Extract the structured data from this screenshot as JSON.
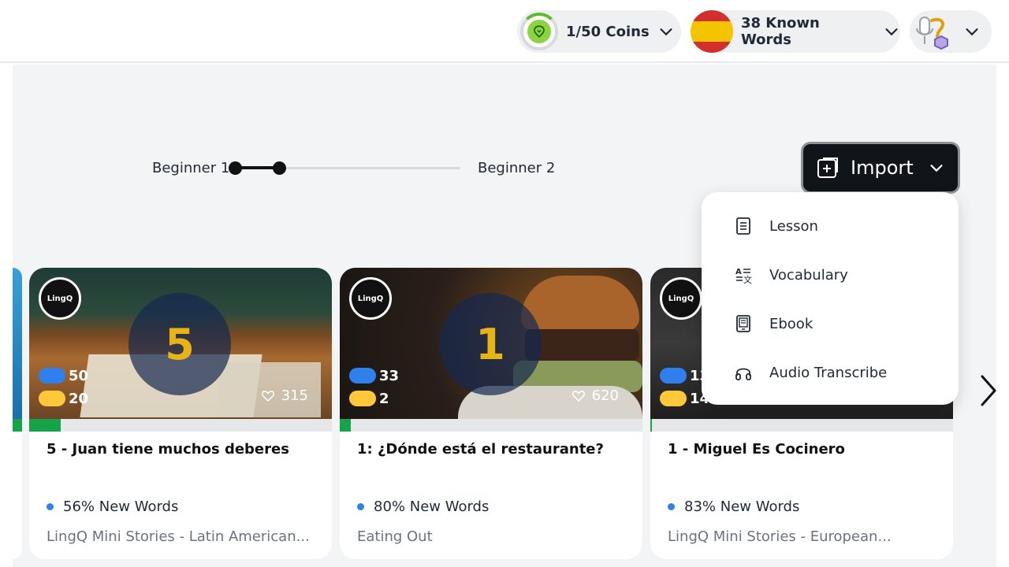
{
  "header": {
    "coins_label": "1/50 Coins",
    "words_label": "38 Known Words"
  },
  "levels": {
    "from": "Beginner 1",
    "to": "Beginner 2"
  },
  "import_button": {
    "label": "Import"
  },
  "import_menu": {
    "items": [
      {
        "label": "Lesson",
        "icon": "document-icon"
      },
      {
        "label": "Vocabulary",
        "icon": "translate-icon"
      },
      {
        "label": "Ebook",
        "icon": "ebook-icon"
      },
      {
        "label": "Audio Transcribe",
        "icon": "headphones-icon"
      }
    ]
  },
  "cards": [
    {
      "badge": "LingQ",
      "number": "5",
      "blue_stat": "50",
      "yellow_stat": "20",
      "likes": "315",
      "progress": 0.1,
      "title": "5 - Juan tiene muchos deberes",
      "new_words": "56% New Words",
      "course": "LingQ Mini Stories - Latin American..."
    },
    {
      "badge": "LingQ",
      "number": "1",
      "blue_stat": "33",
      "yellow_stat": "2",
      "likes": "620",
      "progress": 0.035,
      "title": "1: ¿Dónde está el restaurante?",
      "new_words": "80% New Words",
      "course": "Eating Out"
    },
    {
      "badge": "LingQ",
      "number": "",
      "blue_stat": "13",
      "yellow_stat": "14",
      "likes": "",
      "progress": 0.005,
      "title": "1 - Miguel Es Cocinero",
      "new_words": "83% New Words",
      "course": "LingQ Mini Stories - European..."
    }
  ],
  "colors": {
    "accent_blue": "#2f80ed",
    "accent_yellow": "#ffc83a",
    "progress_green": "#16a34a",
    "dark_button": "#111418"
  }
}
